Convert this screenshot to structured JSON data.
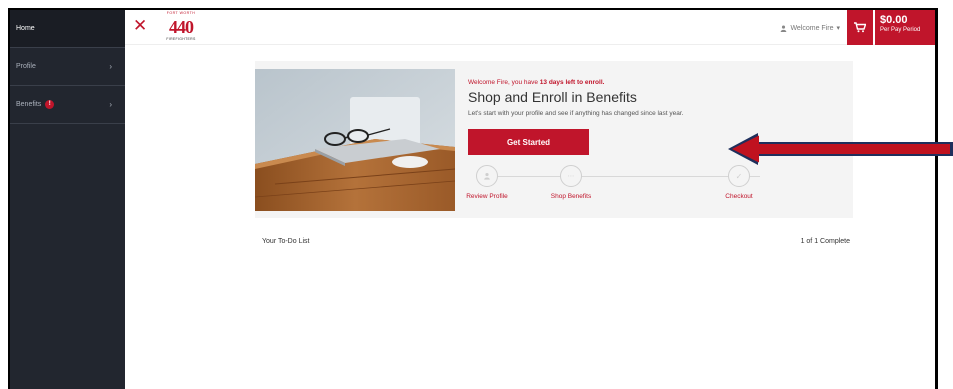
{
  "sidebar": {
    "items": [
      {
        "label": "Home"
      },
      {
        "label": "Profile"
      },
      {
        "label": "Benefits",
        "badge": "!"
      }
    ]
  },
  "header": {
    "close_icon": "close-icon",
    "logo": {
      "top": "FORT WORTH",
      "number": "440",
      "bottom": "FIREFIGHTERS"
    },
    "welcome": "Welcome Fire",
    "cart_icon": "cart-icon",
    "price": "$0.00",
    "price_sub": "Per Pay Period"
  },
  "hero": {
    "message_prefix": "Welcome Fire, you have ",
    "message_bold": "13 days left to enroll.",
    "headline": "Shop and Enroll in Benefits",
    "subtext": "Let's start with your profile and see if anything has changed since last year.",
    "cta": "Get Started",
    "steps": [
      {
        "label": "Review Profile",
        "icon": "user-icon"
      },
      {
        "label": "Shop Benefits",
        "icon": "dollar-icon"
      },
      {
        "label": "Checkout",
        "icon": "check-icon"
      }
    ]
  },
  "todo": {
    "title": "Your To-Do List",
    "count": "1 of 1 Complete"
  },
  "colors": {
    "accent": "#c0152b",
    "sidebar": "#22262f",
    "card": "#f4f4f4"
  }
}
